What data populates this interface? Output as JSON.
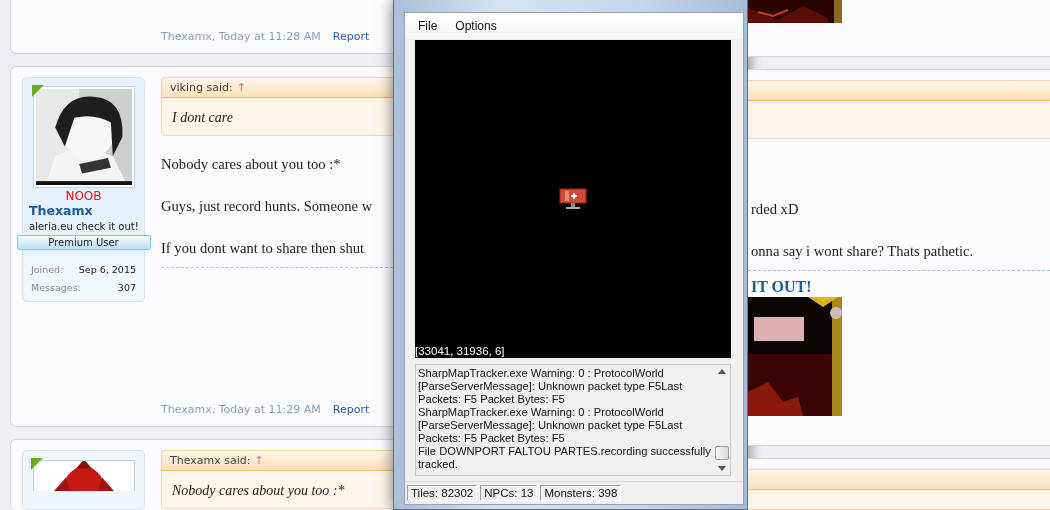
{
  "top_post": {
    "author_time": "Thexamx, Today at 11:28 AM",
    "report": "Report"
  },
  "post": {
    "user": {
      "rank": "NOOB",
      "name": "Thexamx",
      "title": "aleria.eu check it out!",
      "badge": "Premium User",
      "stats": [
        {
          "label": "Joined:",
          "value": "Sep 6, 2015"
        },
        {
          "label": "Messages:",
          "value": "307"
        }
      ]
    },
    "quote": {
      "author": "viking said:",
      "arrow": "↑",
      "text": "I dont care"
    },
    "paragraphs": [
      {
        "left": "Nobody cares about you too :*"
      },
      {
        "left": "Guys, just record hunts. Someone w",
        "right": "rded xD"
      },
      {
        "left": "If you dont want to share then shut",
        "right": "onna say i wont share? Thats pathetic."
      }
    ],
    "signature": "IT OUT!",
    "author_time": "Thexamx, Today at 11:29 AM",
    "report": "Report"
  },
  "next_post": {
    "quote": {
      "author": "Thexamx said:",
      "arrow": "↑",
      "text": "Nobody cares about you too :*"
    }
  },
  "window": {
    "menu": [
      "File",
      "Options"
    ],
    "coords": "[33041, 31936, 6]",
    "log": [
      "SharpMapTracker.exe Warning: 0 : ProtocolWorld [ParseServerMessage]: Unknown packet type F5Last Packets: F5 Packet Bytes: F5",
      "SharpMapTracker.exe Warning: 0 : ProtocolWorld [ParseServerMessage]: Unknown packet type F5Last Packets: F5 Packet Bytes: F5",
      "File DOWNPORT FALTOU PARTES.recording successfully tracked."
    ],
    "status": [
      "Tiles: 82302",
      "NPCs: 13",
      "Monsters: 398"
    ]
  }
}
